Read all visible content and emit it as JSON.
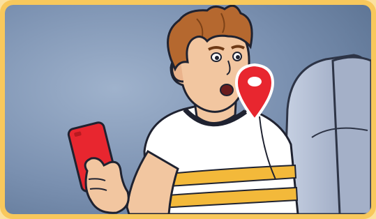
{
  "illustration": {
    "icons": {
      "location_pin": "location-pin-icon",
      "phone": "smartphone"
    },
    "colors": {
      "frame": "#f8c85c",
      "background_wall": "#7a90b0",
      "seat": "#b9c4da",
      "skin": "#f2c6a0",
      "hair": "#b5682f",
      "shirt": "#ffffff",
      "shirt_stripe": "#f3b93a",
      "phone": "#e8262f",
      "pin": "#e8262f"
    }
  }
}
